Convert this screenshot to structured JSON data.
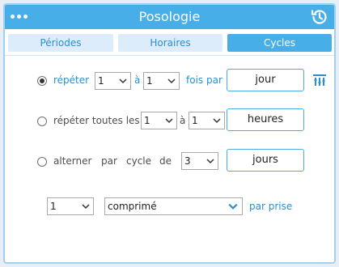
{
  "window": {
    "title": "Posologie"
  },
  "icons": {
    "menu": "menu-dots-icon",
    "history": "history-icon",
    "settings": "vertical-sliders-icon"
  },
  "tabs": [
    {
      "label": "Périodes",
      "active": false
    },
    {
      "label": "Horaires",
      "active": false
    },
    {
      "label": "Cycles",
      "active": true
    }
  ],
  "rows": {
    "repeat": {
      "selected": true,
      "label": "répéter",
      "from_value": "1",
      "between_label": "à",
      "to_value": "1",
      "unit_prefix": "fois par",
      "unit_button": "jour"
    },
    "repeat_every": {
      "selected": false,
      "label": "répéter toutes les",
      "from_value": "1",
      "between_label": "à",
      "to_value": "1",
      "unit_button": "heures"
    },
    "alternate": {
      "selected": false,
      "word1": "alterner",
      "word2": "par",
      "word3": "cycle",
      "word4": "de",
      "value": "3",
      "unit_button": "jours"
    }
  },
  "dose": {
    "quantity": "1",
    "form": "comprimé",
    "suffix": "par prise"
  },
  "colors": {
    "accent": "#48aee8",
    "link": "#2a8fd0",
    "tab_inactive": "#dcecfa"
  }
}
